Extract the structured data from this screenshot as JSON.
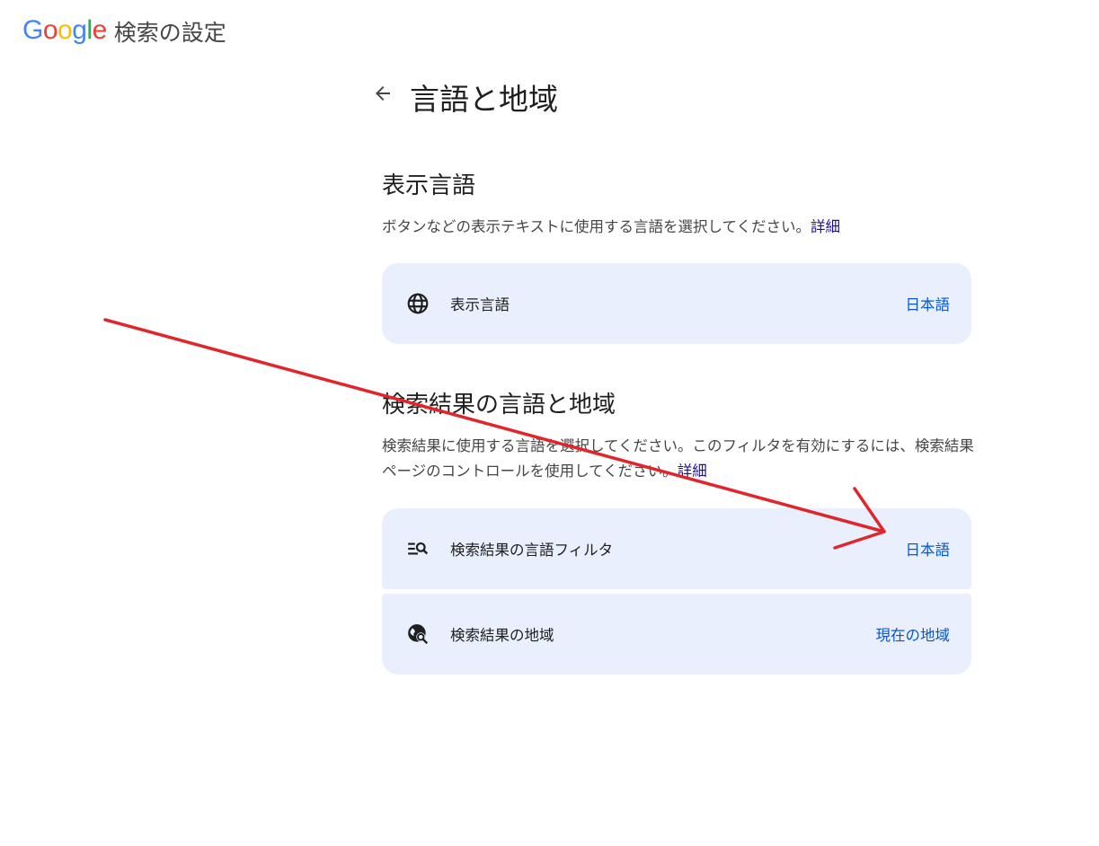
{
  "header": {
    "logo_letters": [
      "G",
      "o",
      "o",
      "g",
      "l",
      "e"
    ],
    "logo_colors": [
      "#4285F4",
      "#EA4335",
      "#FBBC05",
      "#4285F4",
      "#34A853",
      "#EA4335"
    ],
    "page_heading": "検索の設定"
  },
  "main": {
    "title": "言語と地域",
    "back_icon": "arrow-left-icon"
  },
  "display_language": {
    "heading": "表示言語",
    "description": "ボタンなどの表示テキストに使用する言語を選択してください。",
    "details_link": "詳細",
    "item": {
      "icon": "globe-icon",
      "label": "表示言語",
      "value": "日本語"
    }
  },
  "search_results": {
    "heading": "検索結果の言語と地域",
    "description": "検索結果に使用する言語を選択してください。このフィルタを有効にするには、検索結果ページのコントロールを使用してください。",
    "details_link": "詳細",
    "items": [
      {
        "icon": "search-filter-icon",
        "label": "検索結果の言語フィルタ",
        "value": "日本語"
      },
      {
        "icon": "globe-search-icon",
        "label": "検索結果の地域",
        "value": "現在の地域"
      }
    ]
  },
  "colors": {
    "card_bg": "#e9effd",
    "value_text": "#0b57d0",
    "link_text": "#1a0dab",
    "annotation_arrow": "#e0252d"
  }
}
